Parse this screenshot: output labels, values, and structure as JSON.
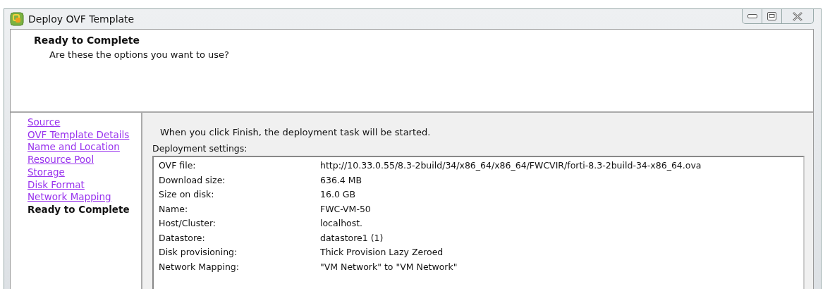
{
  "window": {
    "title": "Deploy OVF Template"
  },
  "header": {
    "title": "Ready to Complete",
    "subtitle": "Are these the options you want to use?"
  },
  "steps": [
    {
      "label": "Source",
      "selected": false
    },
    {
      "label": "OVF Template Details",
      "selected": false
    },
    {
      "label": "Name and Location",
      "selected": false
    },
    {
      "label": "Resource Pool",
      "selected": false
    },
    {
      "label": "Storage",
      "selected": false
    },
    {
      "label": "Disk Format",
      "selected": false
    },
    {
      "label": "Network Mapping",
      "selected": false
    },
    {
      "label": "Ready to Complete",
      "selected": true
    }
  ],
  "intro": "When you click Finish, the deployment task will be started.",
  "settings": {
    "title": "Deployment settings:",
    "rows": [
      {
        "label": "OVF file:",
        "value": "http://10.33.0.55/8.3-2build/34/x86_64/x86_64/FWCVIR/forti-8.3-2build-34-x86_64.ova"
      },
      {
        "label": "Download size:",
        "value": "636.4 MB"
      },
      {
        "label": "Size on disk:",
        "value": "16.0 GB"
      },
      {
        "label": "Name:",
        "value": "FWC-VM-50"
      },
      {
        "label": "Host/Cluster:",
        "value": "localhost."
      },
      {
        "label": "Datastore:",
        "value": "datastore1 (1)"
      },
      {
        "label": "Disk provisioning:",
        "value": "Thick Provision Lazy Zeroed"
      },
      {
        "label": "Network Mapping:",
        "value": "\"VM Network\" to \"VM Network\""
      }
    ]
  }
}
